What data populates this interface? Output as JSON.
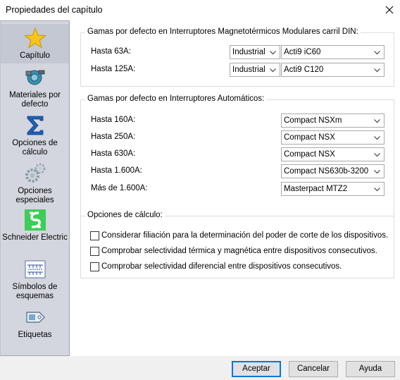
{
  "window": {
    "title": "Propiedades del capítulo",
    "close_icon": "close-icon"
  },
  "sidebar": {
    "items": [
      {
        "label": "Capítulo",
        "icon": "star-icon",
        "selected": true
      },
      {
        "label": "Materiales por defecto",
        "icon": "materials-icon",
        "selected": false
      },
      {
        "label": "Opciones de cálculo",
        "icon": "sigma-icon",
        "selected": false
      },
      {
        "label": "Opciones especiales",
        "icon": "gears-icon",
        "selected": false
      },
      {
        "label": "Schneider Electric",
        "icon": "schneider-logo-icon",
        "selected": false
      },
      {
        "label": "Símbolos de esquemas",
        "icon": "schematic-symbols-icon",
        "selected": false
      },
      {
        "label": "Etiquetas",
        "icon": "tag-icon",
        "selected": false
      }
    ]
  },
  "group_din": {
    "legend": "Gamas por defecto en Interruptores Magnetotérmicos Modulares carril DIN:",
    "rows": [
      {
        "label": "Hasta 63A:",
        "type": "Industrial",
        "range": "Acti9 iC60"
      },
      {
        "label": "Hasta 125A:",
        "type": "Industrial",
        "range": "Acti9 C120"
      }
    ]
  },
  "group_auto": {
    "legend": "Gamas por defecto en Interruptores Automáticos:",
    "rows": [
      {
        "label": "Hasta 160A:",
        "range": "Compact NSXm"
      },
      {
        "label": "Hasta 250A:",
        "range": "Compact NSX"
      },
      {
        "label": "Hasta 630A:",
        "range": "Compact NSX"
      },
      {
        "label": "Hasta 1.600A:",
        "range": "Compact NS630b-3200"
      },
      {
        "label": "Más de 1.600A:",
        "range": "Masterpact MTZ2"
      }
    ]
  },
  "group_calc": {
    "legend": "Opciones de cálculo:",
    "options": [
      {
        "label": "Considerar filiación para la determinación del poder de corte de los dispositivos.",
        "checked": false
      },
      {
        "label": "Comprobar selectividad térmica y magnética entre dispositivos consecutivos.",
        "checked": false
      },
      {
        "label": "Comprobar selectividad diferencial entre dispositivos consecutivos.",
        "checked": false
      }
    ]
  },
  "buttons": {
    "accept": "Aceptar",
    "cancel": "Cancelar",
    "help": "Ayuda"
  },
  "colors": {
    "sidebar_bg": "#d3d6de",
    "default_button_border": "#0078d7",
    "schneider_green": "#3dcd58"
  }
}
